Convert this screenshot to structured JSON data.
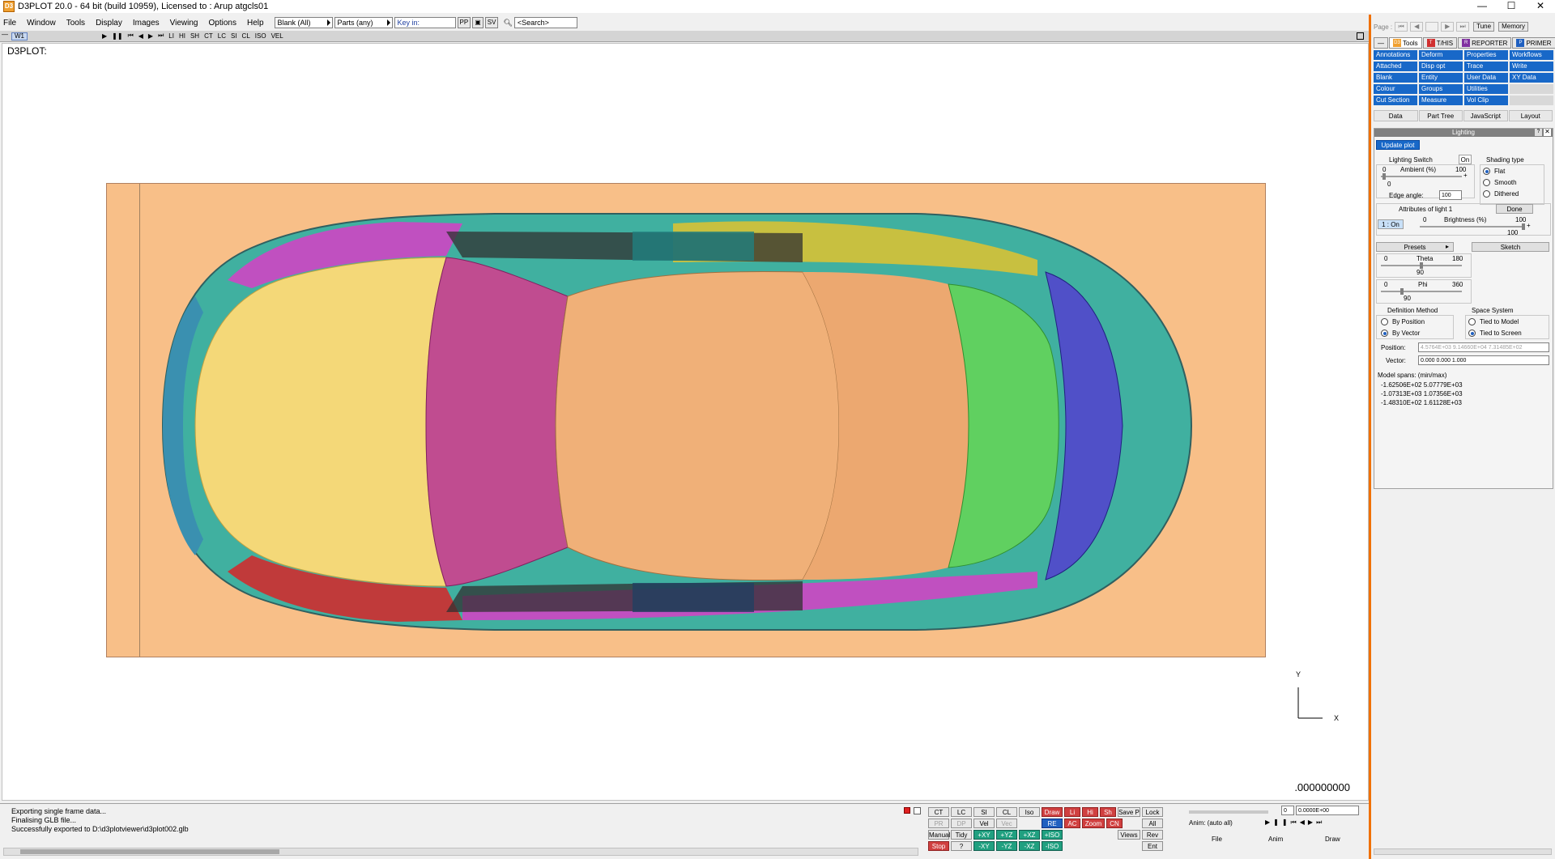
{
  "window": {
    "title": "D3PLOT 20.0 - 64 bit (build 10959), Licensed to : Arup atgcls01",
    "app_icon": "D3",
    "minimize": "—",
    "maximize": "☐",
    "close": "✕"
  },
  "menu": {
    "items": [
      "File",
      "Window",
      "Tools",
      "Display",
      "Images",
      "Viewing",
      "Options",
      "Help"
    ],
    "blank_combo": "Blank (All)",
    "parts_combo": "Parts (any)",
    "keyin_placeholder": "Key in:",
    "pp": "PP",
    "sv": "SV",
    "search_placeholder": "<Search>"
  },
  "viewbar": {
    "tab": "W1",
    "controls": [
      "▶",
      "❚❚",
      "⏮",
      "◀",
      "▶",
      "⏭",
      "LI",
      "HI",
      "SH",
      "CT",
      "LC",
      "SI",
      "CL",
      "ISO",
      "VEL"
    ]
  },
  "viewport": {
    "label": "D3PLOT:",
    "axis_x": "X",
    "axis_y": "Y",
    "frame_counter": ".000000000"
  },
  "log": {
    "lines": [
      "Exporting single frame data...",
      "Finalising GLB file...",
      "Successfully exported to D:\\d3plotviewer\\d3plot002.glb"
    ]
  },
  "toolbar_grid": {
    "row1": [
      "CT",
      "LC",
      "SI",
      "CL",
      "Iso",
      "Draw",
      "Li",
      "Hi",
      "Sh",
      "Save P",
      "Lock"
    ],
    "row2": [
      "PR",
      "DP",
      "Vel",
      "Vec",
      "RE",
      "AC",
      "Zoom",
      "CN",
      "All"
    ],
    "row3": [
      "Manual",
      "Tidy",
      "+XY",
      "+YZ",
      "+XZ",
      "+ISO",
      "Views",
      "Rev"
    ],
    "row4": [
      "Stop",
      "?",
      "-XY",
      "-YZ",
      "-XZ",
      "-ISO",
      "Ent"
    ]
  },
  "anim_panel": {
    "value": "0",
    "time": "0.0000E+00",
    "label": "Anim: (auto all)",
    "menus": [
      "File",
      "Anim",
      "Draw"
    ]
  },
  "sidebar": {
    "page_label": "Page :",
    "tune": "Tune",
    "memory": "Memory",
    "app_tabs": [
      {
        "badge": "D3",
        "label": "Tools"
      },
      {
        "badge": "T",
        "label": "T/HIS"
      },
      {
        "badge": "R",
        "label": "REPORTER"
      },
      {
        "badge": "P",
        "label": "PRIMER"
      }
    ],
    "tools": [
      "Annotations",
      "Deform",
      "Properties",
      "Workflows",
      "Attached",
      "Disp opt",
      "Trace",
      "Write",
      "Blank",
      "Entity",
      "User Data",
      "XY Data",
      "Colour",
      "Groups",
      "Utilities",
      "",
      "Cut Section",
      "Measure",
      "Vol Clip",
      ""
    ],
    "sub_tabs": [
      "Data",
      "Part Tree",
      "JavaScript",
      "Layout"
    ]
  },
  "lighting": {
    "title": "Lighting",
    "update_plot": "Update plot",
    "lighting_switch": "Lighting Switch",
    "switch_state": "On",
    "shading_type": "Shading type",
    "flat": "Flat",
    "smooth": "Smooth",
    "dithered": "Dithered",
    "ambient_label": "Ambient (%)",
    "ambient_min": "0",
    "ambient_max": "100",
    "ambient_value": "0",
    "edge_angle_label": "Edge angle:",
    "edge_angle": "100",
    "attributes_label": "Attributes of light 1",
    "done": "Done",
    "light_on": "1 : On",
    "brightness_label": "Brightness (%)",
    "brightness_min": "0",
    "brightness_max": "100",
    "brightness_value": "100",
    "presets": "Presets",
    "sketch": "Sketch",
    "theta_label": "Theta",
    "theta_min": "0",
    "theta_max": "180",
    "theta_value": "90",
    "phi_label": "Phi",
    "phi_min": "0",
    "phi_max": "360",
    "phi_value": "90",
    "definition_method": "Definition Method",
    "by_position": "By Position",
    "by_vector": "By Vector",
    "space_system": "Space System",
    "tied_model": "Tied to Model",
    "tied_screen": "Tied to Screen",
    "position_label": "Position:",
    "position_value": "4.5764E+03  9.14660E+04  7.31485E+02",
    "vector_label": "Vector:",
    "vector_value": "0.000  0.000  1.000",
    "spans_label": "Model spans: (min/max)",
    "spans": [
      "-1.62506E+02   5.07779E+03",
      "-1.07313E+03   1.07356E+03",
      "-1.48310E+02   1.61128E+03"
    ]
  },
  "colors": {
    "accent": "#f07000",
    "tool_blue": "#1868c8",
    "plate": "#f8bf88"
  }
}
